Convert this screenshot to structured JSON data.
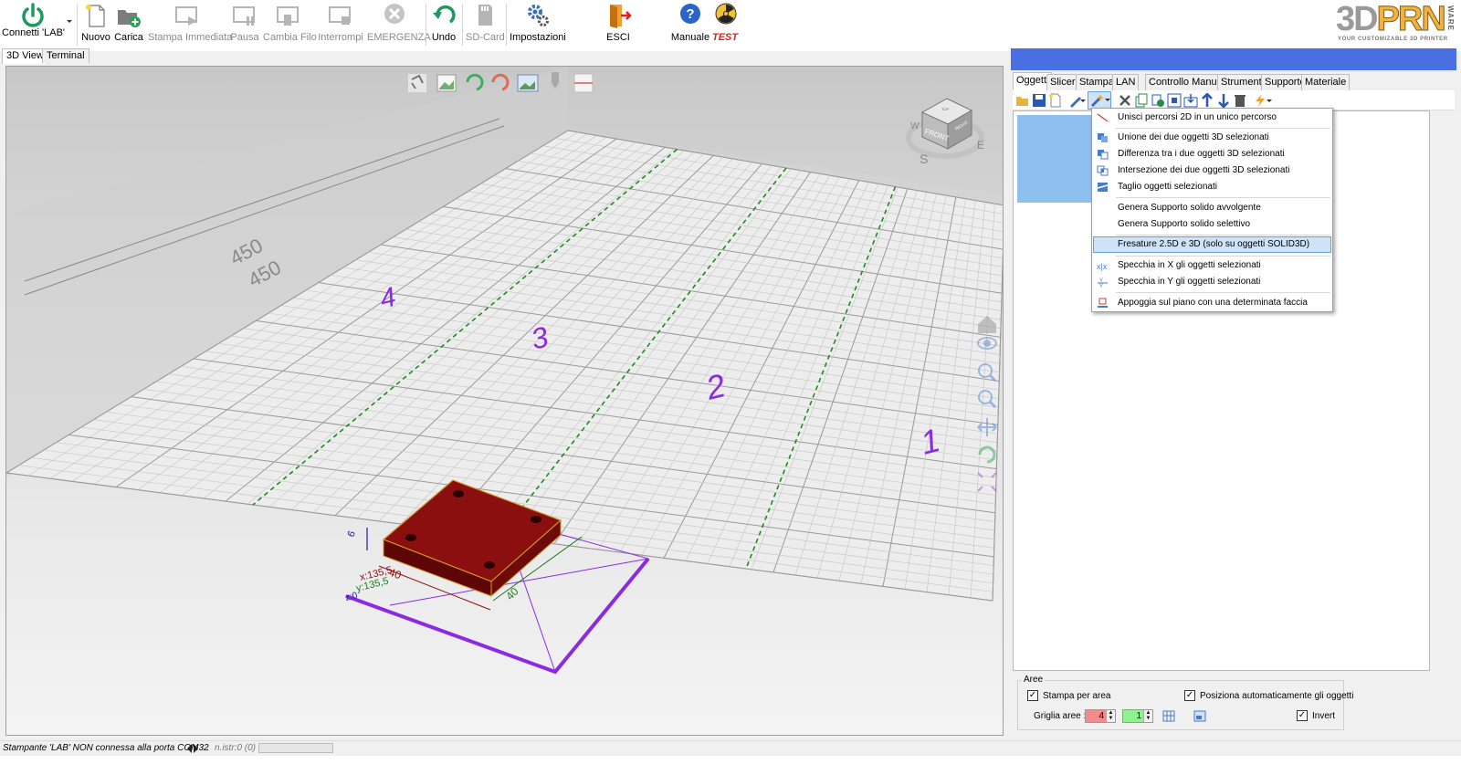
{
  "toolbar": {
    "connect_label": "Connetti 'LAB'",
    "new_label": "Nuovo",
    "load_label": "Carica",
    "print_now_label": "Stampa Immediata",
    "pause_label": "Pausa",
    "change_filament_label": "Cambia Filo",
    "interrupt_label": "Interrompi",
    "emergency_label": "EMERGENZA",
    "undo_label": "Undo",
    "sdcard_label": "SD-Card",
    "settings_label": "Impostazioni",
    "exit_label": "ESCI",
    "manual_label": "Manuale",
    "test_label": "TEST",
    "test_color": "#e0201a"
  },
  "logo": {
    "main_3d": "3D",
    "main_prn": "PRN",
    "ware": "WARE",
    "tagline": "YOUR CUSTOMIZABLE 3D PRINTER"
  },
  "view_tabs": [
    "3D View",
    "Terminal"
  ],
  "viewport": {
    "dim_x": "450",
    "dim_y": "450",
    "area_labels": [
      "1",
      "2",
      "3",
      "4"
    ],
    "object_dim_w": "40",
    "object_dim_d": "40",
    "object_dim_h": "6",
    "coord_x": "x:135,5",
    "coord_y": "y:135,5",
    "coord_z": "z:0",
    "viewcube_front": "FRONT",
    "viewcube_right": "RIGHT",
    "viewcube_top": "TOP",
    "compass_s": "S",
    "compass_e": "E",
    "compass_w": "W",
    "object_color": "#8b0f0f",
    "area_color": "#8a2be2"
  },
  "right_tabs": [
    "Oggetti",
    "Slicer",
    "Stampa",
    "LAN",
    "Controllo Manuale",
    "Strumenti",
    "Supporto",
    "Materiale"
  ],
  "menu": {
    "items": [
      "Unisci percorsi 2D in un unico percorso",
      "Unione dei due oggetti 3D selezionati",
      "Differenza tra i due oggetti 3D selezionati",
      "Intersezione dei due oggetti 3D selezionati",
      "Taglio oggetti selezionati",
      "Genera Supporto solido avvolgente",
      "Genera Supporto solido selettivo",
      "Fresature 2.5D e 3D (solo su oggetti SOLID3D)",
      "Specchia in X gli oggetti selezionati",
      "Specchia in Y gli oggetti selezionati",
      "Appoggia sul piano con una determinata faccia"
    ],
    "highlighted": "Fresature 2.5D e 3D (solo su oggetti SOLID3D)"
  },
  "aree": {
    "legend": "Aree",
    "print_by_area_label": "Stampa per area",
    "print_by_area_checked": true,
    "auto_position_label": "Posiziona automaticamente gli oggetti",
    "auto_position_checked": true,
    "grid_label": "Griglia aree :",
    "grid_x_value": "4",
    "grid_y_value": "1",
    "grid_x_color": "#f28b8b",
    "grid_y_color": "#8ef28e",
    "invert_label": "Invert",
    "invert_checked": true
  },
  "status": {
    "text": "Stampante 'LAB' NON connessa alla porta COM32",
    "instr": "n.istr:0 (0)",
    "dot": "."
  }
}
